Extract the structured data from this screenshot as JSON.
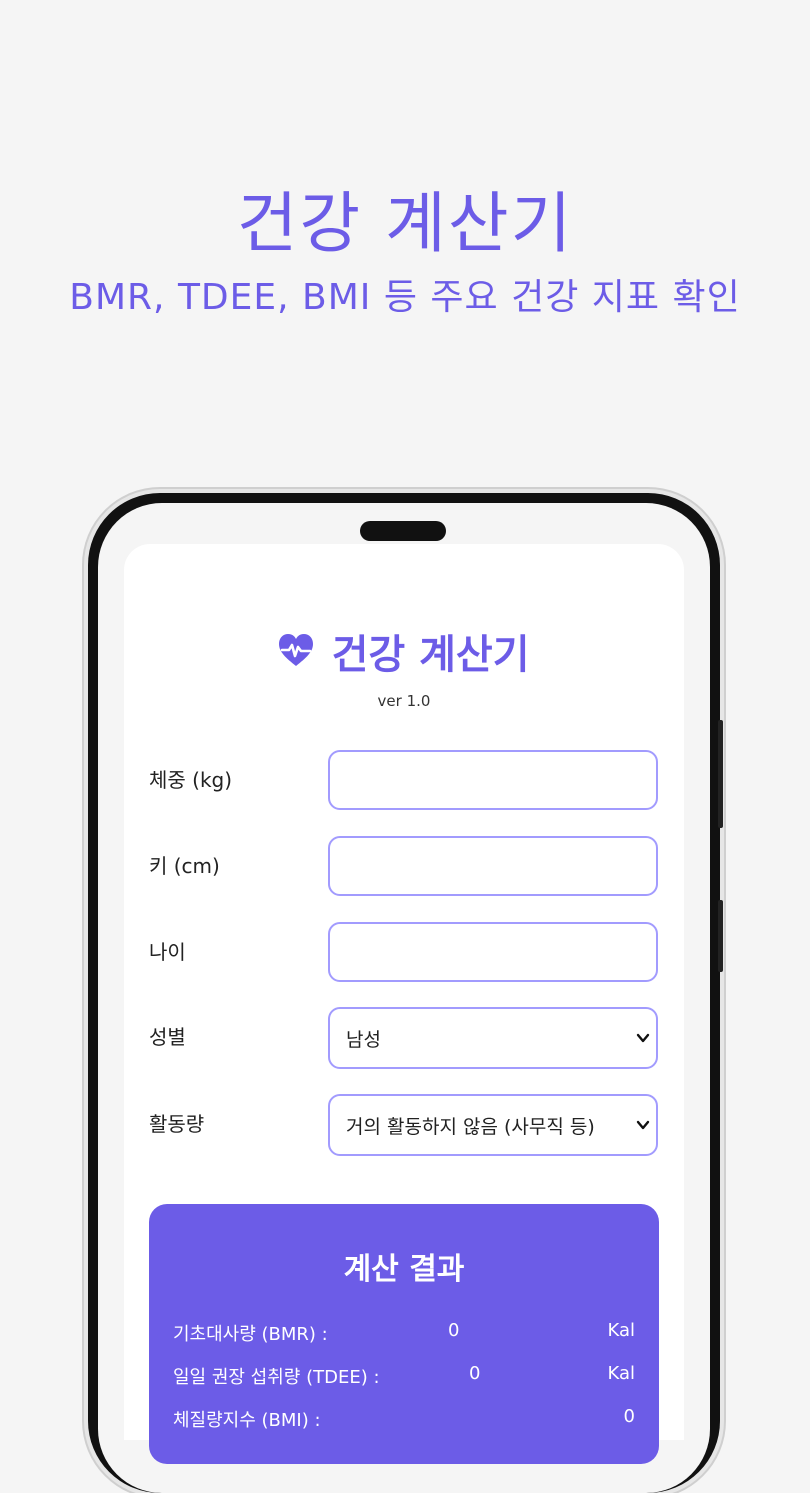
{
  "promo": {
    "title": "건강 계산기",
    "subtitle": "BMR, TDEE, BMI 등 주요 건강 지표 확인"
  },
  "app": {
    "title": "건강 계산기",
    "version": "ver 1.0",
    "accent_color": "#6c5ce7",
    "border_color": "#a29bfe",
    "icon": "heart-pulse-icon"
  },
  "form": {
    "weight_label": "체중 (kg)",
    "height_label": "키 (cm)",
    "age_label": "나이",
    "gender_label": "성별",
    "gender_value": "남성",
    "activity_label": "활동량",
    "activity_value": "거의 활동하지 않음 (사무직 등)"
  },
  "result": {
    "title": "계산 결과",
    "bmr_label": "기초대사량 (BMR) :",
    "bmr_value": "0",
    "bmr_unit": "Kal",
    "tdee_label": "일일 권장 섭취량 (TDEE) :",
    "tdee_value": "0",
    "tdee_unit": "Kal",
    "bmi_label": "체질량지수 (BMI) :",
    "bmi_value": "0"
  }
}
